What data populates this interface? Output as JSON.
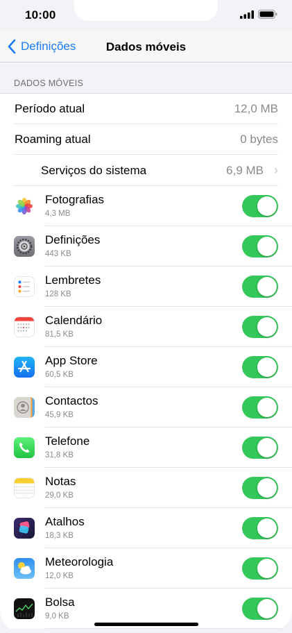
{
  "status_bar": {
    "time": "10:00"
  },
  "nav": {
    "back_label": "Definições",
    "title": "Dados móveis"
  },
  "section": {
    "header": "DADOS MÓVEIS"
  },
  "summary": [
    {
      "label": "Período atual",
      "value": "12,0 MB"
    },
    {
      "label": "Roaming atual",
      "value": "0 bytes"
    }
  ],
  "system_services": {
    "label": "Serviços do sistema",
    "value": "6,9 MB"
  },
  "apps": [
    {
      "name": "Fotografias",
      "size": "4,3 MB",
      "icon": "photos-icon",
      "enabled": true
    },
    {
      "name": "Definições",
      "size": "443 KB",
      "icon": "settings-icon",
      "enabled": true
    },
    {
      "name": "Lembretes",
      "size": "128 KB",
      "icon": "reminders-icon",
      "enabled": true
    },
    {
      "name": "Calendário",
      "size": "81,5 KB",
      "icon": "calendar-icon",
      "enabled": true
    },
    {
      "name": "App Store",
      "size": "60,5 KB",
      "icon": "app-store-icon",
      "enabled": true
    },
    {
      "name": "Contactos",
      "size": "45,9 KB",
      "icon": "contacts-icon",
      "enabled": true
    },
    {
      "name": "Telefone",
      "size": "31,8 KB",
      "icon": "phone-icon",
      "enabled": true
    },
    {
      "name": "Notas",
      "size": "29,0 KB",
      "icon": "notes-icon",
      "enabled": true
    },
    {
      "name": "Atalhos",
      "size": "18,3 KB",
      "icon": "shortcuts-icon",
      "enabled": true
    },
    {
      "name": "Meteorologia",
      "size": "12,0 KB",
      "icon": "weather-icon",
      "enabled": true
    },
    {
      "name": "Bolsa",
      "size": "9,0 KB",
      "icon": "stocks-icon",
      "enabled": true
    }
  ],
  "colors": {
    "accent": "#1a7cf5",
    "toggle_on": "#34c759"
  }
}
